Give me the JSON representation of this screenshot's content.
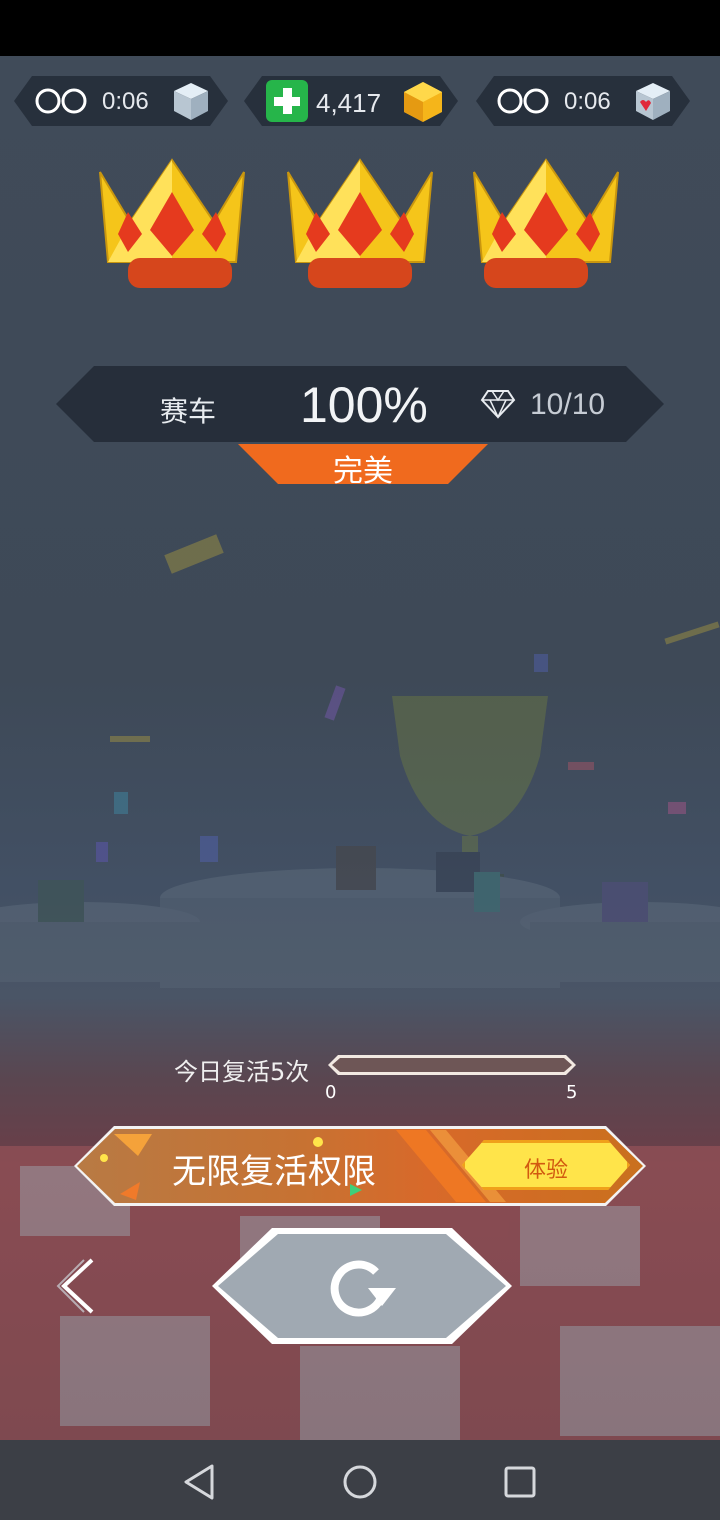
{
  "hud": {
    "left_timer": "0:06",
    "coins": "4,417",
    "right_timer": "0:06"
  },
  "crowns": {
    "count": 3,
    "earned": 3
  },
  "result": {
    "level_name": "赛车",
    "percent": "100%",
    "gems": "10/10",
    "rating": "完美"
  },
  "revive": {
    "label": "今日复活5次",
    "min": "0",
    "max": "5",
    "progress": 0
  },
  "promo": {
    "title": "无限复活权限",
    "action": "体验"
  },
  "colors": {
    "accent_orange": "#f06a1e",
    "gold": "#f5c51a",
    "crown_base": "#d6461c",
    "hud_bg": "#27303c",
    "promo_yellow": "#ffe44a"
  },
  "icons": {
    "left_pill": [
      "infinity-icon",
      "cube-icon"
    ],
    "center_pill": [
      "plus-icon",
      "coin-gem-icon"
    ],
    "right_pill": [
      "infinity-icon",
      "heart-cube-icon"
    ],
    "result": "diamond-icon",
    "nav": [
      "back-triangle-icon",
      "home-circle-icon",
      "recent-square-icon"
    ]
  }
}
